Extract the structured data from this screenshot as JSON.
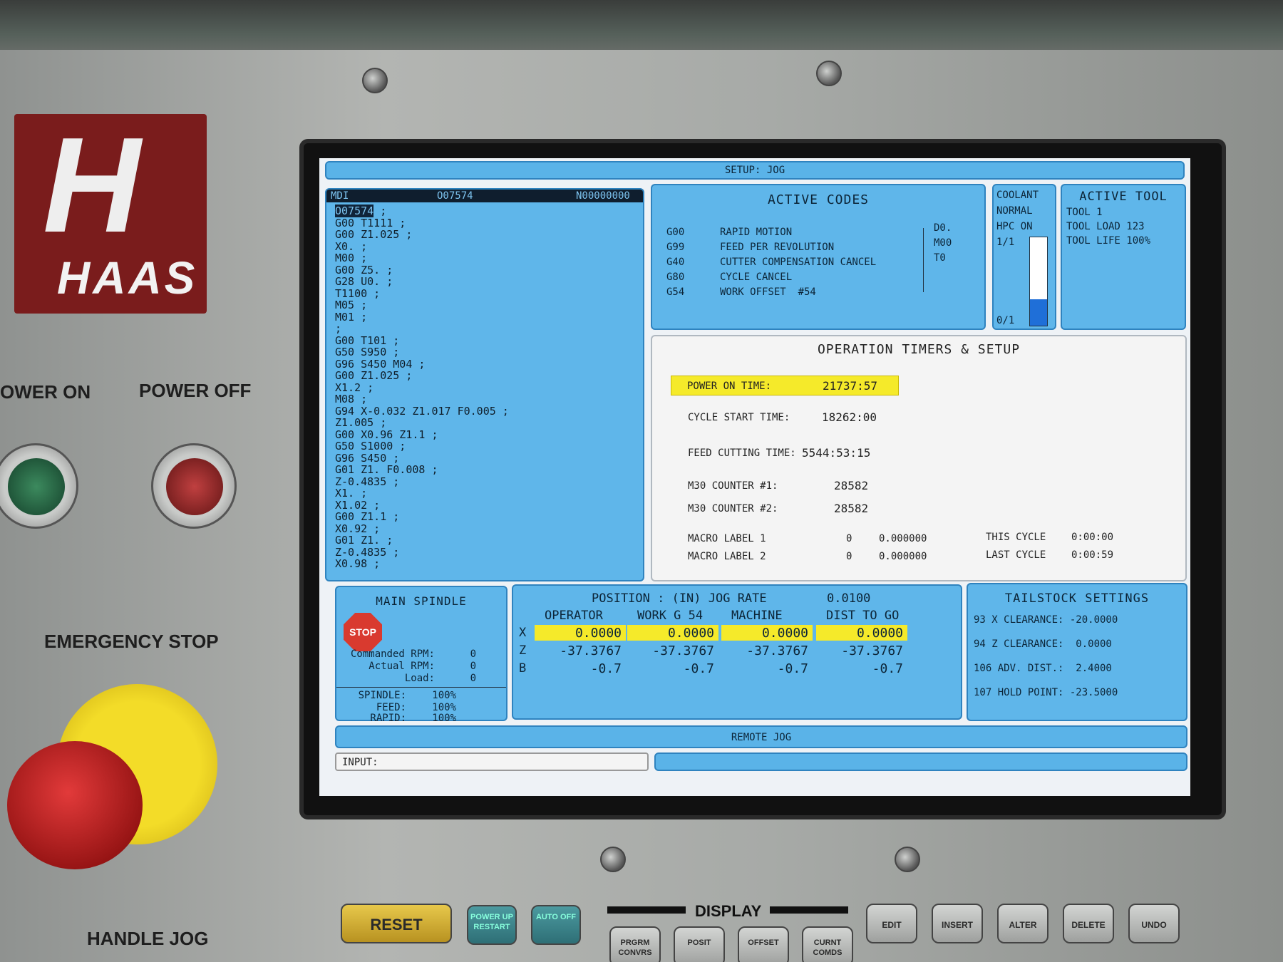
{
  "panel": {
    "brand": "HAAS",
    "power_on_label": "OWER ON",
    "power_off_label": "POWER OFF",
    "emergency_stop_label": "EMERGENCY STOP",
    "handle_jog_label": "HANDLE JOG"
  },
  "screen": {
    "title_bar": "SETUP: JOG",
    "mdi": {
      "mode": "MDI",
      "program": "O07574",
      "sequence": "N00000000",
      "lines": [
        "O07574 ;",
        "G00 T1111 ;",
        "G00 Z1.025 ;",
        "X0. ;",
        "M00 ;",
        "G00 Z5. ;",
        "G28 U0. ;",
        "T1100 ;",
        "M05 ;",
        "M01 ;",
        ";",
        "G00 T101 ;",
        "G50 S950 ;",
        "G96 S450 M04 ;",
        "G00 Z1.025 ;",
        "X1.2 ;",
        "M08 ;",
        "G94 X-0.032 Z1.017 F0.005 ;",
        "Z1.005 ;",
        "G00 X0.96 Z1.1 ;",
        "G50 S1000 ;",
        "G96 S450 ;",
        "G01 Z1. F0.008 ;",
        "Z-0.4835 ;",
        "X1. ;",
        "X1.02 ;",
        "G00 Z1.1 ;",
        "X0.92 ;",
        "G01 Z1. ;",
        "Z-0.4835 ;",
        "X0.98 ;"
      ]
    },
    "active_codes": {
      "title": "ACTIVE CODES",
      "rows": [
        {
          "code": "G00",
          "desc": "RAPID MOTION"
        },
        {
          "code": "G99",
          "desc": "FEED PER REVOLUTION"
        },
        {
          "code": "G40",
          "desc": "CUTTER COMPENSATION CANCEL"
        },
        {
          "code": "G80",
          "desc": "CYCLE CANCEL"
        },
        {
          "code": "G54",
          "desc": "WORK OFFSET  #54"
        }
      ],
      "side": [
        "D0.",
        "M00",
        "T0"
      ]
    },
    "coolant": {
      "title": "COOLANT",
      "status": "NORMAL",
      "hpc": "HPC ON",
      "top_label": "1/1",
      "bottom_label": "0/1",
      "level": 0.3
    },
    "active_tool": {
      "title": "ACTIVE TOOL",
      "tool": "TOOL 1",
      "load": "TOOL LOAD 123",
      "life": "TOOL LIFE 100%"
    },
    "timers": {
      "title": "OPERATION TIMERS & SETUP",
      "power_on_label": "POWER ON TIME:",
      "power_on_value": "21737:57",
      "cycle_start_label": "CYCLE START TIME:",
      "cycle_start_value": "18262:00",
      "feed_cutting_label": "FEED CUTTING TIME:",
      "feed_cutting_value": "5544:53:15",
      "m30_1_label": "M30 COUNTER #1:",
      "m30_1_value": "28582",
      "m30_2_label": "M30 COUNTER #2:",
      "m30_2_value": "28582",
      "macro1_label": "MACRO LABEL 1",
      "macro1_a": "0",
      "macro1_b": "0.000000",
      "macro2_label": "MACRO LABEL 2",
      "macro2_a": "0",
      "macro2_b": "0.000000",
      "this_cycle_label": "THIS CYCLE",
      "this_cycle_value": "0:00:00",
      "last_cycle_label": "LAST CYCLE",
      "last_cycle_value": "0:00:59"
    },
    "spindle": {
      "title": "MAIN SPINDLE",
      "stop": "STOP",
      "cmd_rpm_label": "Commanded RPM:",
      "cmd_rpm": "0",
      "act_rpm_label": "Actual RPM:",
      "act_rpm": "0",
      "load_label": "Load:",
      "load": "0",
      "spindle_label": "SPINDLE:",
      "spindle_ovr": "100%",
      "feed_label": "FEED:",
      "feed_ovr": "100%",
      "rapid_label": "RAPID:",
      "rapid_ovr": "100%"
    },
    "position": {
      "title": "POSITION : (IN) JOG RATE",
      "jog_rate": "0.0100",
      "headers": [
        "OPERATOR",
        "WORK G 54",
        "MACHINE",
        "DIST TO GO"
      ],
      "axes": [
        {
          "axis": "X",
          "values": [
            "0.0000",
            "0.0000",
            "0.0000",
            "0.0000"
          ]
        },
        {
          "axis": "Z",
          "values": [
            "-37.3767",
            "-37.3767",
            "-37.3767",
            "-37.3767"
          ]
        },
        {
          "axis": "B",
          "values": [
            "-0.7",
            "-0.7",
            "-0.7",
            "-0.7"
          ]
        }
      ]
    },
    "tailstock": {
      "title": "TAILSTOCK SETTINGS",
      "rows": [
        "93 X CLEARANCE: -20.0000",
        "94 Z CLEARANCE:  0.0000",
        "106 ADV. DIST.:  2.4000",
        "107 HOLD POINT: -23.5000"
      ]
    },
    "remote_jog": "REMOTE JOG",
    "input_label": "INPUT:"
  },
  "keyboard": {
    "reset": "RESET",
    "power_up": "POWER UP RESTART",
    "auto_off": "AUTO OFF",
    "display": "DISPLAY",
    "keys": [
      "PRGRM CONVRS",
      "POSIT",
      "OFFSET",
      "CURNT COMDS"
    ],
    "edit_keys": [
      "EDIT",
      "INSERT",
      "ALTER",
      "DELETE",
      "UNDO"
    ]
  }
}
